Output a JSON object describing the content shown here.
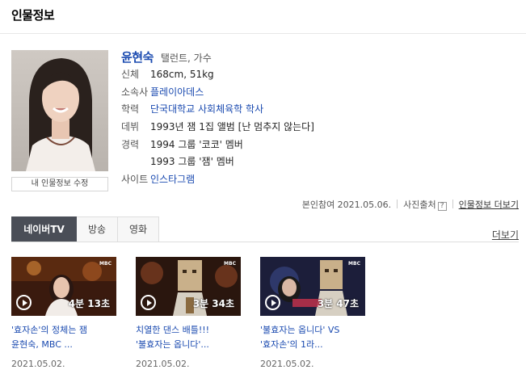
{
  "section_title": "인물정보",
  "person": {
    "name": "윤현숙",
    "role": "탤런트, 가수",
    "edit_label": "내 인물정보 수정",
    "rows": [
      {
        "label": "신체",
        "value": "168cm, 51kg"
      },
      {
        "label": "소속사",
        "value": "플레이아데스"
      },
      {
        "label": "학력",
        "value": "단국대학교 사회체육학 학사"
      },
      {
        "label": "데뷔",
        "value": "1993년 잼 1집 앨범 [난 멈추지 않는다]"
      },
      {
        "label": "경력",
        "value": "1994 그룹 '코코' 멤버"
      },
      {
        "label": "",
        "value": "1993 그룹 '잼' 멤버"
      },
      {
        "label": "사이트",
        "value": "인스타그램"
      }
    ]
  },
  "meta": {
    "participation": "본인참여 2021.05.06.",
    "photo_source": "사진출처",
    "help": "?",
    "more": "인물정보 더보기"
  },
  "tabs": [
    {
      "label": "네이버TV",
      "active": true
    },
    {
      "label": "방송",
      "active": false
    },
    {
      "label": "영화",
      "active": false
    }
  ],
  "tabs_more": "더보기",
  "videos": [
    {
      "duration": "4분 13초",
      "title": "'효자손'의 정체는 잼 윤현숙, MBC ...",
      "date": "2021.05.02.",
      "channel": "MBC"
    },
    {
      "duration": "3분 34초",
      "title": "치열한 댄스 배틀!!! '불효자는 옵니다'...",
      "date": "2021.05.02.",
      "channel": "MBC"
    },
    {
      "duration": "3분 47초",
      "title": "'불효자는 옵니다' VS '효자손'의 1라...",
      "date": "2021.05.02.",
      "channel": "MBC"
    }
  ],
  "colors": {
    "link": "#1a4ab0",
    "tab_active": "#4a4e57"
  }
}
